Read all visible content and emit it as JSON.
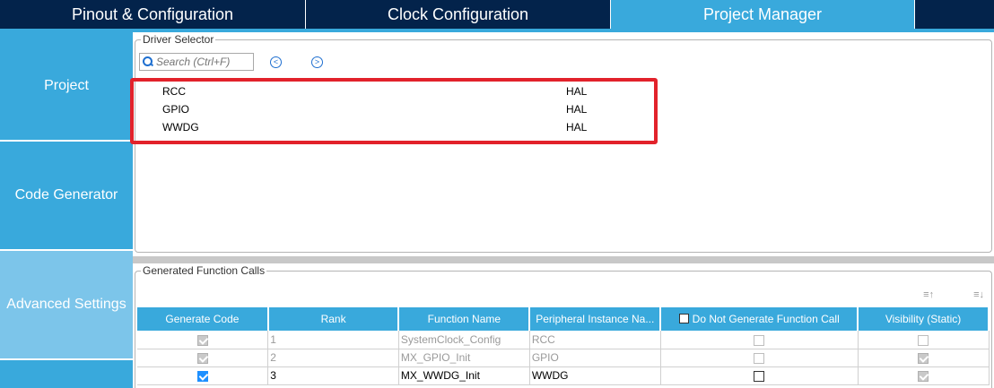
{
  "tabs": [
    {
      "label": "Pinout & Configuration"
    },
    {
      "label": "Clock Configuration"
    },
    {
      "label": "Project Manager"
    }
  ],
  "sidebar": {
    "items": [
      {
        "label": "Project"
      },
      {
        "label": "Code Generator"
      },
      {
        "label": "Advanced Settings"
      }
    ]
  },
  "driver_selector": {
    "legend": "Driver Selector",
    "search_placeholder": "Search (Ctrl+F)",
    "prev_icon": "<",
    "next_icon": ">",
    "rows": [
      {
        "name": "RCC",
        "driver": "HAL"
      },
      {
        "name": "GPIO",
        "driver": "HAL"
      },
      {
        "name": "WWDG",
        "driver": "HAL"
      }
    ]
  },
  "function_calls": {
    "legend": "Generated Function Calls",
    "sort_asc_icon": "≡↑",
    "sort_desc_icon": "≡↓",
    "headers": {
      "generate_code": "Generate Code",
      "rank": "Rank",
      "function_name": "Function Name",
      "peripheral_instance": "Peripheral Instance Na...",
      "do_not_generate": "Do Not Generate Function Call",
      "visibility": "Visibility (Static)"
    },
    "rows": [
      {
        "rank": "1",
        "function": "SystemClock_Config",
        "peripheral": "RCC"
      },
      {
        "rank": "2",
        "function": "MX_GPIO_Init",
        "peripheral": "GPIO"
      },
      {
        "rank": "3",
        "function": "MX_WWDG_Init",
        "peripheral": "WWDG"
      }
    ]
  },
  "colors": {
    "dark_tab": "#03234b",
    "accent": "#39a9dc",
    "highlight": "#e2222b"
  }
}
